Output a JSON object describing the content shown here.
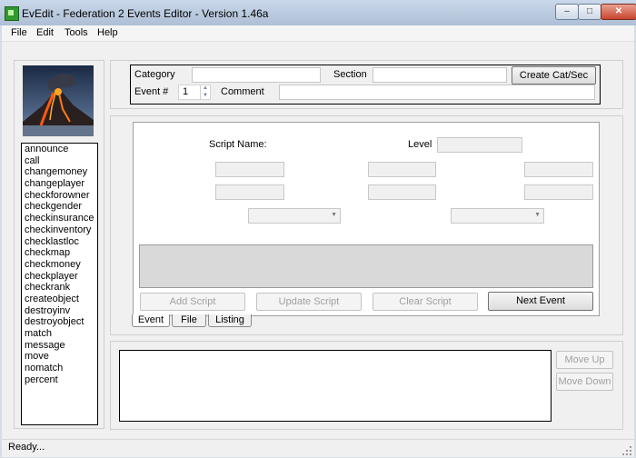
{
  "window": {
    "title": "EvEdit - Federation 2 Events Editor - Version 1.46a",
    "min_glyph": "–",
    "max_glyph": "□",
    "close_glyph": "✕"
  },
  "menu": [
    "File",
    "Edit",
    "Tools",
    "Help"
  ],
  "header": {
    "category_label": "Category",
    "category_value": "",
    "section_label": "Section",
    "section_value": "",
    "create_button": "Create Cat/Sec",
    "event_label": "Event #",
    "event_value": "1",
    "comment_label": "Comment",
    "comment_value": ""
  },
  "commands": [
    "announce",
    "call",
    "changemoney",
    "changeplayer",
    "checkforowner",
    "checkgender",
    "checkinsurance",
    "checkinventory",
    "checklastloc",
    "checkmap",
    "checkmoney",
    "checkplayer",
    "checkrank",
    "createobject",
    "destroyinv",
    "destroyobject",
    "match",
    "message",
    "move",
    "nomatch",
    "percent"
  ],
  "editor": {
    "script_name_label": "Script Name:",
    "level_label": "Level",
    "buttons": {
      "add": "Add Script",
      "update": "Update Script",
      "clear": "Clear Script",
      "next": "Next Event"
    }
  },
  "tabs": [
    "Event",
    "File",
    "Listing"
  ],
  "events": {
    "move_up": "Move Up",
    "move_down": "Move Down"
  },
  "status": "Ready...",
  "colors": {
    "accent": "#2f9a2f",
    "titlebar": "#bfcfe3"
  }
}
